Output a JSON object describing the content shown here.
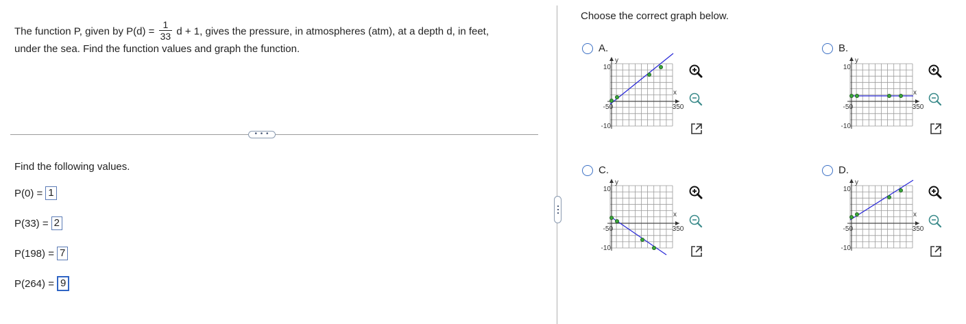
{
  "problem": {
    "intro": "The function P, given by P(d) =",
    "frac_num": "1",
    "frac_den": "33",
    "rest": "d + 1, gives the pressure, in atmospheres (atm), at a depth d, in feet,",
    "line2": "under the sea. Find the function values and graph the function."
  },
  "find_label": "Find the following values.",
  "answers": [
    {
      "label": "P(0) =",
      "value": "1"
    },
    {
      "label": "P(33) =",
      "value": "2"
    },
    {
      "label": "P(198) =",
      "value": "7"
    },
    {
      "label": "P(264) =",
      "value": "9"
    }
  ],
  "right": {
    "title": "Choose the correct graph below."
  },
  "options": [
    {
      "label": "A.",
      "graph": {
        "xmin": "-50",
        "xmax": "350",
        "ymax": "10",
        "ymin": "-10",
        "xlabel": "x",
        "ylabel": "y"
      }
    },
    {
      "label": "B.",
      "graph": {
        "xmin": "-50",
        "xmax": "350",
        "ymax": "10",
        "ymin": "-10",
        "xlabel": "x",
        "ylabel": "y"
      }
    },
    {
      "label": "C.",
      "graph": {
        "xmin": "-50",
        "xmax": "350",
        "ymax": "10",
        "ymin": "-10",
        "xlabel": "x",
        "ylabel": "y"
      }
    },
    {
      "label": "D.",
      "graph": {
        "xmin": "-50",
        "xmax": "350",
        "ymax": "10",
        "ymin": "-10",
        "xlabel": "x",
        "ylabel": "y"
      }
    }
  ],
  "colors": {
    "line": "#2a2ad8",
    "point": "#3aa63a",
    "accent": "#3a6fc4",
    "grid": "#9a9a9a"
  },
  "icons": [
    "zoom-in-icon",
    "zoom-out-icon",
    "open-new-window-icon",
    "more-options-icon"
  ]
}
